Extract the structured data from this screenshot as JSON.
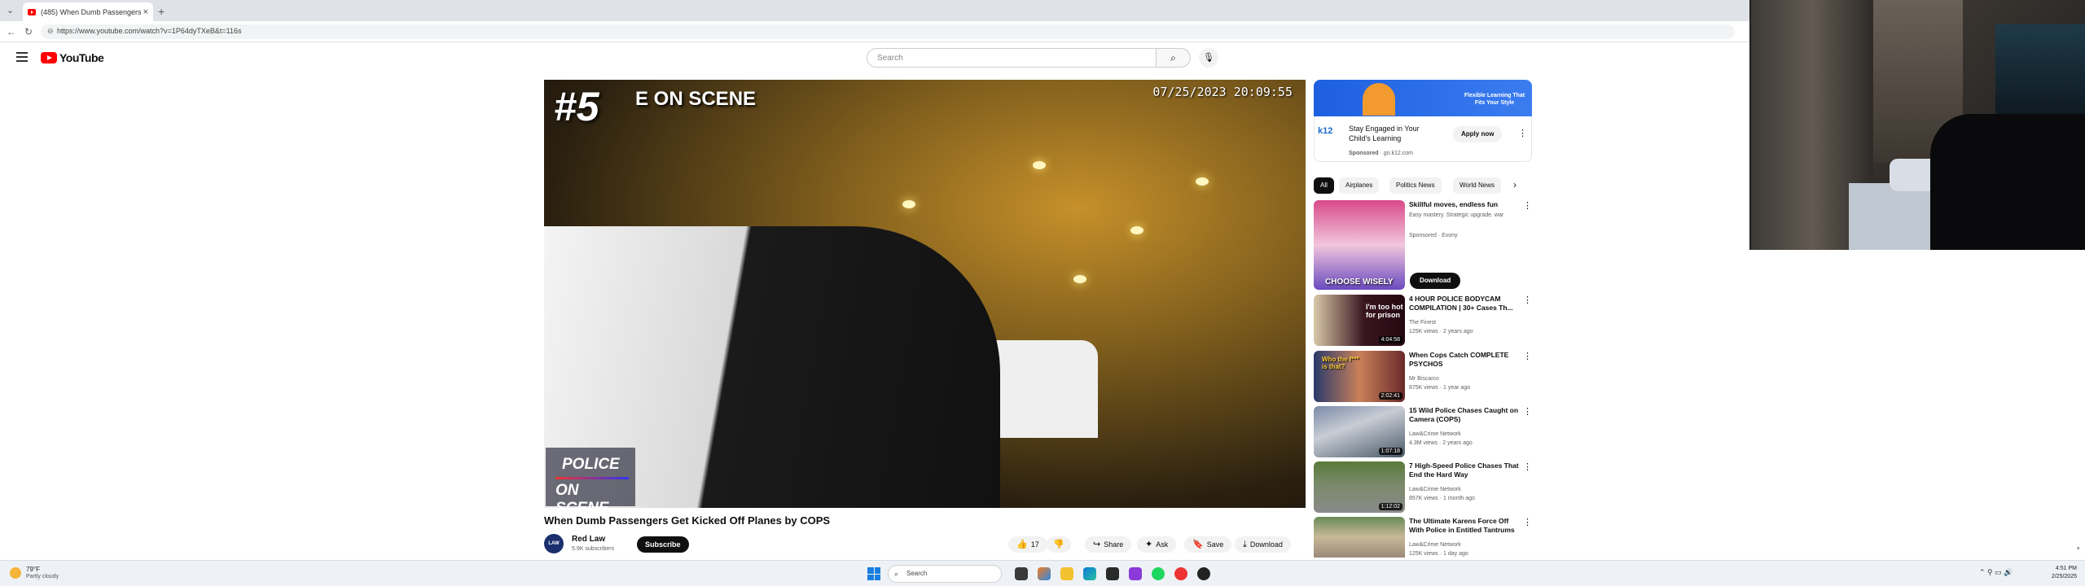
{
  "browser": {
    "tab_title": "(485) When Dumb Passengers",
    "url": "https://www.youtube.com/watch?v=1P64dyTXeB&t=116s"
  },
  "youtube": {
    "logo_text": "YouTube",
    "search_placeholder": "Search"
  },
  "player": {
    "rank_text": "#5",
    "overlay_text": "E ON SCENE",
    "timestamp": "07/25/2023 20:09:55",
    "badge_line1": "POLICE",
    "badge_line2": "ON SCENE"
  },
  "video": {
    "title": "When Dumb Passengers Get Kicked Off Planes by COPS",
    "channel": "Red Law",
    "channel_avatar_text": "LAW",
    "subscribers": "5.9K subscribers",
    "subscribe_label": "Subscribe",
    "likes": "17",
    "share_label": "Share",
    "ask_label": "Ask",
    "save_label": "Save",
    "download_label": "Download"
  },
  "ad": {
    "banner_text": "Flexible Learning That Fits Your Style",
    "brand": "k12",
    "title": "Stay Engaged in Your Child's Learning",
    "sponsored": "Sponsored",
    "domain": "go.k12.com",
    "apply_label": "Apply now"
  },
  "chips": [
    "All",
    "Airplanes",
    "Politics News",
    "World News"
  ],
  "recommendations": [
    {
      "title": "Skillful moves, endless fun",
      "channel": "Easy mastery. Strategic upgrade. war",
      "meta": "Sponsored · Evony",
      "duration": "",
      "thumb_text": "CHOOSE WISELY",
      "cta": "Download"
    },
    {
      "title": "4 HOUR POLICE BODYCAM COMPILATION | 30+ Cases Th...",
      "channel": "The Finest",
      "meta": "125K views · 2 years ago",
      "duration": "4:04:58",
      "thumb_text": "I'm too hot for prison"
    },
    {
      "title": "When Cops Catch COMPLETE PSYCHOS",
      "channel": "Mr Biscarco",
      "meta": "875K views · 1 year ago",
      "duration": "2:02:41",
      "thumb_text": "Who the f*** is that?"
    },
    {
      "title": "15 Wild Police Chases Caught on Camera (COPS)",
      "channel": "Law&Crime Network",
      "meta": "4.3M views · 2 years ago",
      "duration": "1:07:18",
      "thumb_text": ""
    },
    {
      "title": "7 High-Speed Police Chases That End the Hard Way",
      "channel": "Law&Crime Network",
      "meta": "857K views · 1 month ago",
      "duration": "1:12:02",
      "thumb_text": ""
    },
    {
      "title": "The Ultimate Karens Force Off With Police in Entitled Tantrums",
      "channel": "Law&Crime Network",
      "meta": "125K views · 1 day ago",
      "duration": "",
      "thumb_text": ""
    }
  ],
  "taskbar": {
    "weather_temp": "79°F",
    "weather_desc": "Partly cloudy",
    "search_label": "Search",
    "time": "4:51 PM",
    "date": "2/25/2025"
  },
  "colors": {
    "youtube_red": "#ff0000",
    "accent_blue": "#1a7ee0"
  }
}
